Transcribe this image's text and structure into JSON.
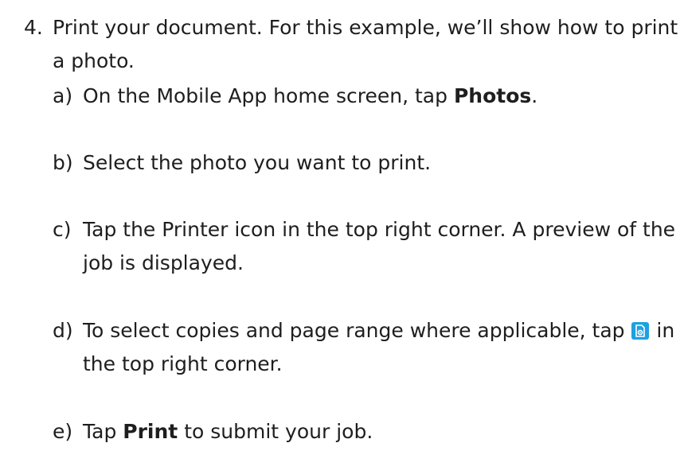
{
  "step": {
    "number": "4.",
    "text": "Print your document. For this example, we’ll show how to print a photo."
  },
  "substeps": [
    {
      "marker": "a)",
      "text_before": "On the Mobile App home screen, tap ",
      "bold": "Photos",
      "text_after": "."
    },
    {
      "marker": "b)",
      "text": "Select the photo you want to print."
    },
    {
      "marker": "c)",
      "text": "Tap the Printer icon in the top right corner. A preview of the job is displayed."
    },
    {
      "marker": "d)",
      "text_before": "To select copies and page range where applicable, tap ",
      "icon": "settings-document-icon",
      "text_after": " in the top right corner."
    },
    {
      "marker": "e)",
      "text_before": "Tap ",
      "bold": "Print",
      "text_after": " to submit your job."
    }
  ],
  "colors": {
    "text": "#1e1e1e",
    "icon_bg": "#1ea1e0",
    "icon_fg": "#ffffff"
  }
}
